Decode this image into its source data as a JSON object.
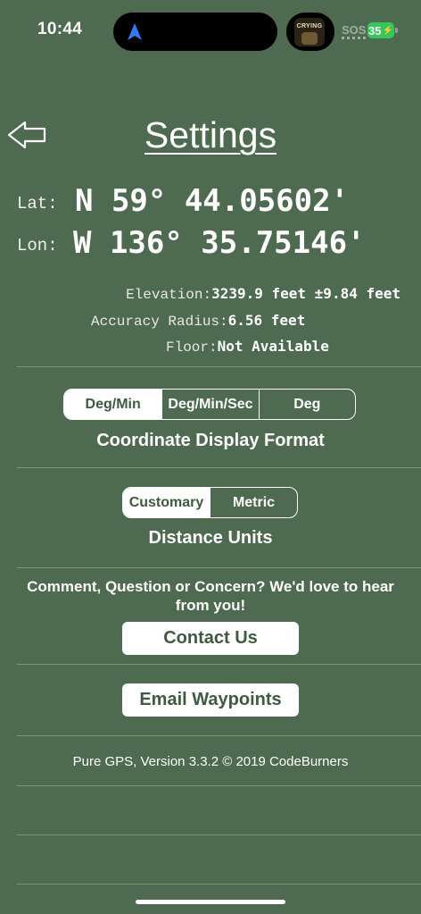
{
  "status_bar": {
    "time": "10:44",
    "cellular": "SOS",
    "battery": "35"
  },
  "header": {
    "title": "Settings"
  },
  "coordinates": {
    "lat_label": "Lat:",
    "lat_value": "N 59° 44.05602'",
    "lon_label": "Lon:",
    "lon_value": "W 136° 35.75146'"
  },
  "details": {
    "elevation_label": "Elevation:",
    "elevation_value": "3239.9 feet ±9.84 feet",
    "accuracy_label": "Accuracy Radius:",
    "accuracy_value": "6.56 feet",
    "floor_label": "Floor:",
    "floor_value": "Not Available"
  },
  "coordinate_format": {
    "options": [
      "Deg/Min",
      "Deg/Min/Sec",
      "Deg"
    ],
    "selected": "Deg/Min",
    "caption": "Coordinate Display Format"
  },
  "distance_units": {
    "options": [
      "Customary",
      "Metric"
    ],
    "selected": "Customary",
    "caption": "Distance Units"
  },
  "feedback": {
    "prompt": "Comment, Question or Concern? We'd love to hear from you!",
    "contact_button": "Contact Us",
    "email_button": "Email Waypoints"
  },
  "footer": {
    "version": "Pure GPS, Version 3.3.2 © 2019 CodeBurners"
  },
  "colors": {
    "background": "#4e6a50",
    "selected_text": "#3f5a43",
    "battery": "#34c759"
  }
}
